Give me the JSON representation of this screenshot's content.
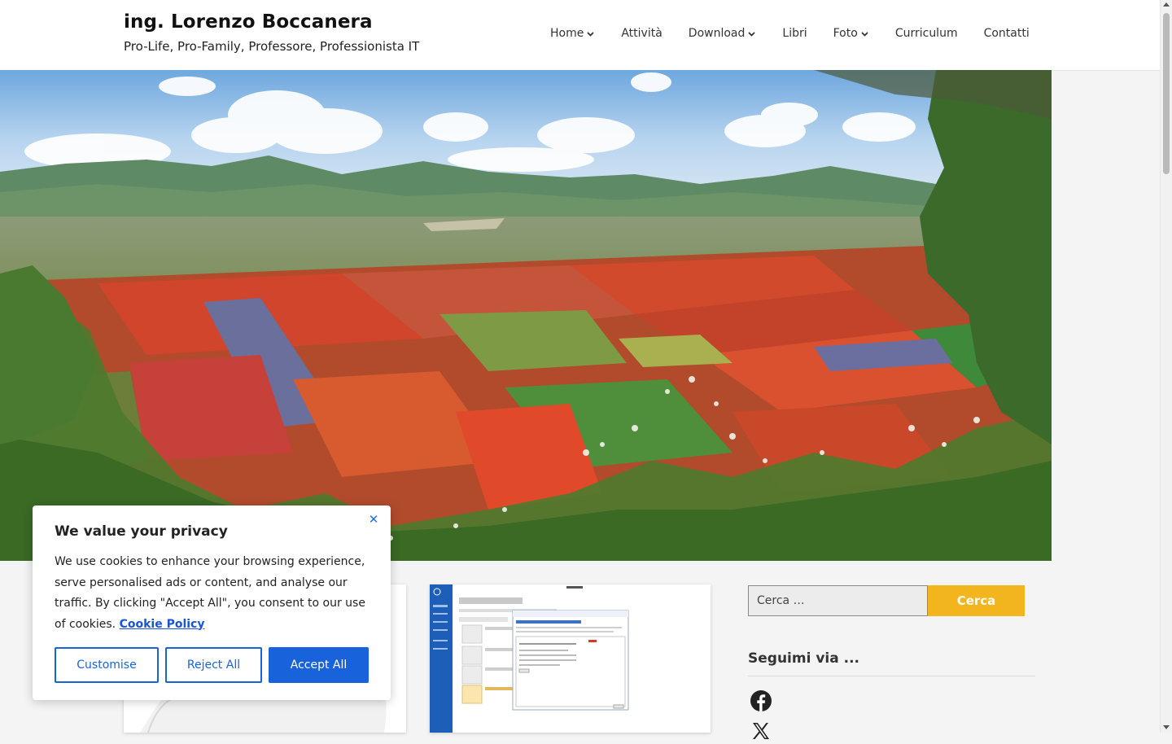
{
  "site": {
    "title": "ing. Lorenzo Boccanera",
    "tagline": "Pro-Life, Pro-Family, Professore, Professionista IT"
  },
  "nav": {
    "items": [
      {
        "label": "Home",
        "has_submenu": true
      },
      {
        "label": "Attività",
        "has_submenu": false
      },
      {
        "label": "Download",
        "has_submenu": true
      },
      {
        "label": "Libri",
        "has_submenu": false
      },
      {
        "label": "Foto",
        "has_submenu": true
      },
      {
        "label": "Curriculum",
        "has_submenu": false
      },
      {
        "label": "Contatti",
        "has_submenu": false
      }
    ]
  },
  "sidebar": {
    "search_placeholder": "Cerca …",
    "search_button": "Cerca",
    "follow_title": "Seguimi via ...",
    "social": [
      "facebook-icon",
      "x-icon"
    ]
  },
  "cookie": {
    "title": "We value your privacy",
    "text": "We use cookies to enhance your browsing experience, serve personalised ads or content, and analyse our traffic. By clicking \"Accept All\", you consent to our use of cookies.",
    "link": "Cookie Policy",
    "customise": "Customise",
    "reject": "Reject All",
    "accept": "Accept All"
  },
  "colors": {
    "accent": "#f2b51d",
    "cookie_primary": "#1863dc"
  }
}
